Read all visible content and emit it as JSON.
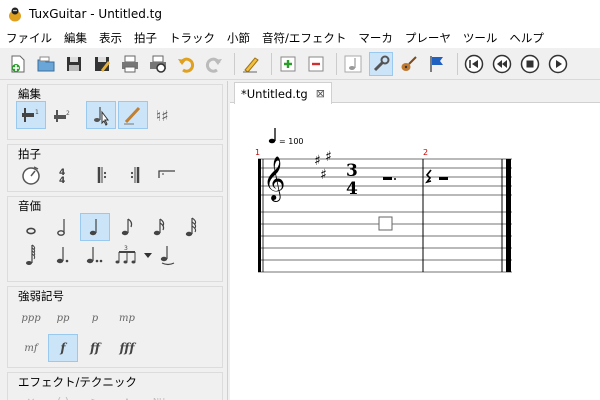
{
  "window": {
    "title": "TuxGuitar - Untitled.tg"
  },
  "menubar": [
    "ファイル",
    "編集",
    "表示",
    "拍子",
    "トラック",
    "小節",
    "音符/エフェクト",
    "マーカ",
    "プレーヤ",
    "ツール",
    "ヘルプ"
  ],
  "toolbar": {
    "buttons": [
      "new-file-icon",
      "open-file-icon",
      "save-icon",
      "save-as-icon",
      "print-icon",
      "print-preview-icon",
      "undo-icon",
      "redo-icon",
      "edit-pencil-icon",
      "add-track-icon",
      "remove-track-icon",
      "note-view-icon",
      "settings-wrench-icon",
      "guitar-icon",
      "flag-icon",
      "first-icon",
      "rewind-icon",
      "stop-icon",
      "play-icon"
    ],
    "active": "settings-wrench-icon"
  },
  "sidebar": {
    "edit_title": "編集",
    "beat_title": "拍子",
    "duration_title": "音価",
    "dynamics_title": "強弱記号",
    "dynamics_row1": [
      "ppp",
      "pp",
      "p",
      "mp"
    ],
    "dynamics_row2": [
      "mf",
      "f",
      "ff",
      "fff"
    ],
    "effects_title": "エフェクト/テクニック",
    "effects_hint": "NH"
  },
  "tab": {
    "label": "*Untitled.tg",
    "close": "⊠"
  },
  "score": {
    "tempo": "= 100",
    "measure1": "1",
    "measure2": "2",
    "time_sig_top": "3",
    "time_sig_bottom": "4",
    "key_signature": "F# C# G# (A major, 3 sharps)"
  }
}
